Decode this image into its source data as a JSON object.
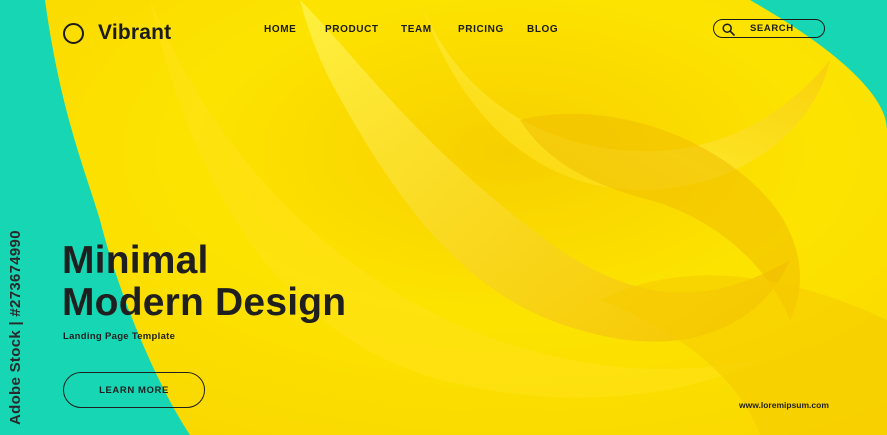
{
  "brand": {
    "name": "Vibrant",
    "logo_icon": "circle-ring-icon"
  },
  "nav": {
    "items": [
      {
        "label": "HOME"
      },
      {
        "label": "PRODUCT"
      },
      {
        "label": "TEAM"
      },
      {
        "label": "PRICING"
      },
      {
        "label": "BLOG"
      }
    ]
  },
  "search": {
    "placeholder": "SEARCH",
    "icon": "search-icon"
  },
  "hero": {
    "line1": "Minimal",
    "line2": "Modern Design",
    "subtitle": "Landing Page Template",
    "cta_label": "LEARN MORE"
  },
  "footer": {
    "url": "www.loremipsum.com"
  },
  "stock_id": "Adobe Stock | #273674990",
  "colors": {
    "teal": "#16d6b4",
    "yellow": "#fbe000",
    "deep_yellow": "#f5c800",
    "text": "#1f1f1f"
  }
}
